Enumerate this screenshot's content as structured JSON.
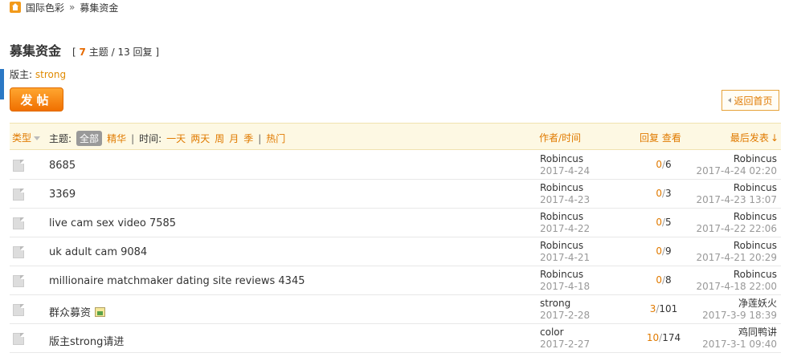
{
  "breadcrumb": {
    "home_label": "国际色彩",
    "separator": "»",
    "current": "募集资金"
  },
  "forum": {
    "name": "募集资金",
    "stats_open": "[",
    "topics": "7",
    "topics_label": "主题",
    "slash": "/",
    "replies": "13",
    "replies_label": "回复",
    "stats_close": "]",
    "moderator_label": "版主:",
    "moderator": "strong"
  },
  "buttons": {
    "post": "发帖",
    "back_home": "返回首页"
  },
  "table_header": {
    "type": "类型",
    "topic_label": "主题:",
    "all": "全部",
    "digest": "精华",
    "time_label": "时间:",
    "one_day": "一天",
    "two_days": "两天",
    "week": "周",
    "month": "月",
    "quarter": "季",
    "hot": "热门",
    "author_time": "作者/时间",
    "reply": "回复",
    "view": "查看",
    "last_post": "最后发表",
    "sort_arrow": "↓"
  },
  "threads": [
    {
      "title": "8685",
      "author": "Robincus",
      "date": "2017-4-24",
      "replies": "0",
      "views": "6",
      "last_user": "Robincus",
      "last_time": "2017-4-24 02:20",
      "has_image": false
    },
    {
      "title": "3369",
      "author": "Robincus",
      "date": "2017-4-23",
      "replies": "0",
      "views": "3",
      "last_user": "Robincus",
      "last_time": "2017-4-23 13:07",
      "has_image": false
    },
    {
      "title": "live cam sex video 7585",
      "author": "Robincus",
      "date": "2017-4-22",
      "replies": "0",
      "views": "5",
      "last_user": "Robincus",
      "last_time": "2017-4-22 22:06",
      "has_image": false
    },
    {
      "title": "uk adult cam 9084",
      "author": "Robincus",
      "date": "2017-4-21",
      "replies": "0",
      "views": "9",
      "last_user": "Robincus",
      "last_time": "2017-4-21 20:29",
      "has_image": false
    },
    {
      "title": "millionaire matchmaker dating site reviews 4345",
      "author": "Robincus",
      "date": "2017-4-18",
      "replies": "0",
      "views": "8",
      "last_user": "Robincus",
      "last_time": "2017-4-18 22:00",
      "has_image": false
    },
    {
      "title": "群众募资",
      "author": "strong",
      "date": "2017-2-28",
      "replies": "3",
      "views": "101",
      "last_user": "净莲妖火",
      "last_time": "2017-3-9 18:39",
      "has_image": true
    },
    {
      "title": "版主strong请进",
      "author": "color",
      "date": "2017-2-27",
      "replies": "10",
      "views": "174",
      "last_user": "鸡同鸭讲",
      "last_time": "2017-3-1 09:40",
      "has_image": false
    }
  ],
  "colors": {
    "accent": "#e07a00",
    "header_bg": "#fdf8e3",
    "button": "#f07000"
  }
}
